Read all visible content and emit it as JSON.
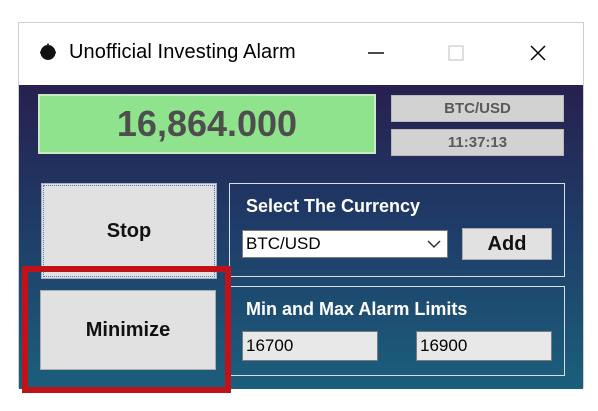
{
  "window": {
    "title": "Unofficial Investing Alarm",
    "minimize_glyph": "—",
    "close_glyph": "✕"
  },
  "display": {
    "price": "16,864.000",
    "pair": "BTC/USD",
    "time": "11:37:13"
  },
  "buttons": {
    "stop_label": "Stop",
    "minimize_label": "Minimize",
    "add_label": "Add"
  },
  "currency_group": {
    "title": "Select The Currency",
    "selected": "BTC/USD"
  },
  "limits_group": {
    "title": "Min and Max Alarm Limits",
    "min_value": "16700",
    "max_value": "16900"
  },
  "colors": {
    "price_bg": "#8ee38c",
    "highlight": "#c1121a",
    "gradient_top": "#27204f",
    "gradient_bottom": "#1b5f7c"
  }
}
